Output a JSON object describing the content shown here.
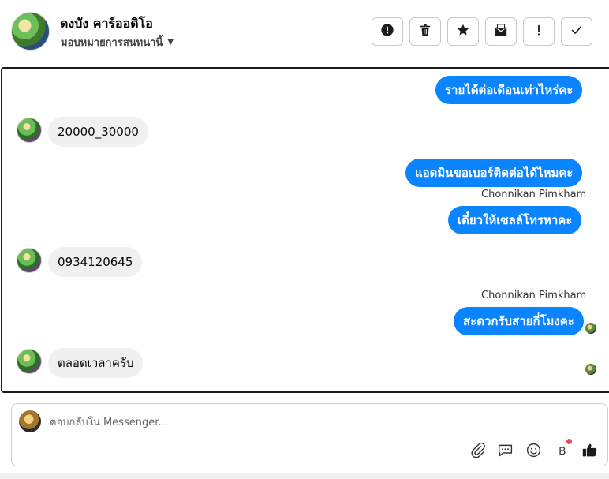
{
  "header": {
    "contact_name": "ดงบัง คาร์ออดิโอ",
    "assign_label": "มอบหมายการสนทนานี้",
    "toolbar": [
      {
        "icon": "alert-circle-icon"
      },
      {
        "icon": "trash-icon"
      },
      {
        "icon": "star-icon"
      },
      {
        "icon": "mark-unread-mail-icon"
      },
      {
        "icon": "exclamation-icon"
      },
      {
        "icon": "check-icon"
      }
    ]
  },
  "messages": [
    {
      "direction": "out",
      "text": "รายได้ต่อเดือนเท่าไหร่คะ"
    },
    {
      "direction": "in",
      "text": "20000_30000"
    },
    {
      "direction": "out",
      "text": "แอดมินขอเบอร์ติดต่อได้ไหมคะ"
    },
    {
      "direction": "out",
      "sender": "Chonnikan Pimkham",
      "text": "เดี๋ยวให้เซลล์โทรหาคะ"
    },
    {
      "direction": "in",
      "text": "0934120645"
    },
    {
      "direction": "out",
      "sender": "Chonnikan Pimkham",
      "text": "สะดวกรับสายกี่โมงคะ"
    },
    {
      "direction": "in",
      "text": "ตลอดเวลาครับ"
    }
  ],
  "composer": {
    "placeholder": "ตอบกลับใน Messenger...",
    "icons": [
      "attachment-icon",
      "saved-reply-icon",
      "emoji-icon",
      "baht-payment-icon",
      "thumbs-up-icon"
    ]
  },
  "colors": {
    "outgoing_bubble": "#0b84ff",
    "incoming_bubble": "#f0f0f0",
    "notification_dot": "#e44a5c"
  }
}
